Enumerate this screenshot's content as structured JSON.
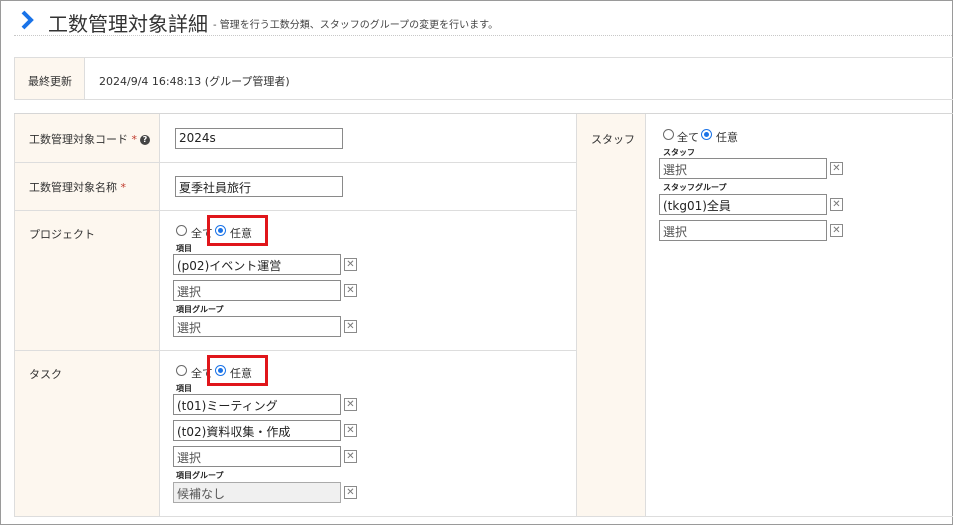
{
  "page": {
    "title": "工数管理対象詳細",
    "subtitle": "- 管理を行う工数分類、スタッフのグループの変更を行います。"
  },
  "update": {
    "label": "最終更新",
    "value": "2024/9/4 16:48:13 (グループ管理者)"
  },
  "form": {
    "code": {
      "label": "工数管理対象コード",
      "required_mark": "*",
      "help_icon": "question-circle-icon",
      "value": "2024s"
    },
    "name": {
      "label": "工数管理対象名称",
      "required_mark": "*",
      "value": "夏季社員旅行"
    },
    "project": {
      "label": "プロジェクト",
      "radio_all": "全て",
      "radio_any": "任意",
      "selected": "任意",
      "items_label": "項目",
      "items": [
        "(p02)イベント運営",
        "選択"
      ],
      "group_label": "項目グループ",
      "groups": [
        "選択"
      ]
    },
    "task": {
      "label": "タスク",
      "radio_all": "全て",
      "radio_any": "任意",
      "selected": "任意",
      "items_label": "項目",
      "items": [
        "(t01)ミーティング",
        "(t02)資料収集・作成",
        "選択"
      ],
      "group_label": "項目グループ",
      "groups": [
        "候補なし"
      ]
    }
  },
  "staff": {
    "label": "スタッフ",
    "radio_all": "全て",
    "radio_any": "任意",
    "selected": "任意",
    "staff_label": "スタッフ",
    "staff_items": [
      "選択"
    ],
    "group_label": "スタッフグループ",
    "groups": [
      "(tkg01)全員",
      "選択"
    ]
  },
  "icons": {
    "remove": "✕",
    "chevron": "chevron-right-icon"
  },
  "colors": {
    "accent": "#1a73e8",
    "label_bg": "#fdf7ef",
    "highlight": "#e0161b",
    "required": "#c0392b"
  }
}
